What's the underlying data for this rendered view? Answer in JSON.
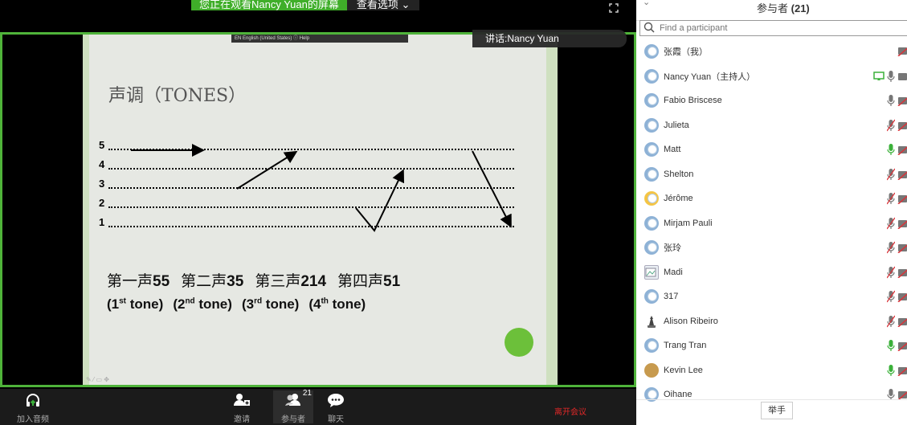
{
  "share_banner": {
    "viewing_text": "您正在观看Nancy Yuan的屏幕",
    "options_label": "查看选项 ⌄"
  },
  "speaker": {
    "label": "讲话:Nancy Yuan"
  },
  "slide": {
    "lang_bar": "EN English (United States)  ⓘ Help",
    "title": "声调（TONES）",
    "levels": [
      "5",
      "4",
      "3",
      "2",
      "1"
    ],
    "tone_names": [
      {
        "cn": "第一声",
        "num": "55"
      },
      {
        "cn": "第二声",
        "num": "35"
      },
      {
        "cn": "第三声",
        "num": "214"
      },
      {
        "cn": "第四声",
        "num": "51"
      }
    ],
    "tone_en": [
      {
        "open": "(1",
        "sup": "st",
        "close": " tone)"
      },
      {
        "open": "(2",
        "sup": "nd",
        "close": " tone)"
      },
      {
        "open": "(3",
        "sup": "rd",
        "close": " tone)"
      },
      {
        "open": "(4",
        "sup": "th",
        "close": " tone)"
      }
    ]
  },
  "toolbar": {
    "join_audio": "加入音频",
    "invite": "邀请",
    "participants": "参与者",
    "participants_count": "21",
    "chat": "聊天",
    "leave": "离开会议"
  },
  "panel": {
    "title": "参与者",
    "count": "(21)",
    "search_placeholder": "Find a participant",
    "raise_hand": "举手",
    "participants": [
      {
        "name": "张霞（我）",
        "avatar": "default",
        "mic": "none",
        "cam": "off",
        "share": false
      },
      {
        "name": "Nancy Yuan（主持人）",
        "avatar": "default",
        "mic": "on-gray",
        "cam": "on",
        "share": true
      },
      {
        "name": "Fabio Briscese",
        "avatar": "default",
        "mic": "on-gray",
        "cam": "off",
        "share": false
      },
      {
        "name": "Julieta",
        "avatar": "default",
        "mic": "muted",
        "cam": "off",
        "share": false
      },
      {
        "name": "Matt",
        "avatar": "default",
        "mic": "on-green",
        "cam": "off",
        "share": false
      },
      {
        "name": "Shelton",
        "avatar": "default",
        "mic": "muted",
        "cam": "off",
        "share": false
      },
      {
        "name": "Jérôme",
        "avatar": "emoji",
        "mic": "muted",
        "cam": "off",
        "share": false
      },
      {
        "name": "Mirjam Pauli",
        "avatar": "default",
        "mic": "muted",
        "cam": "off",
        "share": false
      },
      {
        "name": "张玲",
        "avatar": "default",
        "mic": "muted",
        "cam": "off",
        "share": false
      },
      {
        "name": "Madi",
        "avatar": "broken",
        "mic": "muted",
        "cam": "off",
        "share": false
      },
      {
        "name": "317",
        "avatar": "default",
        "mic": "muted",
        "cam": "off",
        "share": false
      },
      {
        "name": "Alison Ribeiro",
        "avatar": "statue",
        "mic": "muted",
        "cam": "off",
        "share": false
      },
      {
        "name": "Trang Tran",
        "avatar": "default",
        "mic": "on-green",
        "cam": "off",
        "share": false
      },
      {
        "name": "Kevin Lee",
        "avatar": "photo",
        "mic": "on-green",
        "cam": "off",
        "share": false
      },
      {
        "name": "Oihane",
        "avatar": "default",
        "mic": "on-gray",
        "cam": "off",
        "share": false
      }
    ]
  },
  "colors": {
    "share_green": "#3fae29",
    "frame_green": "#4fb33a",
    "leave_red": "#e02828",
    "mic_green": "#3bb13a",
    "cam_off_red": "#d9343a"
  }
}
